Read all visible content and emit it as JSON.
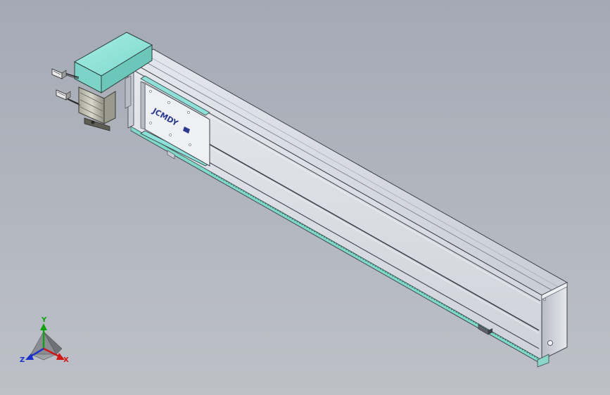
{
  "carriage": {
    "brand_label": "JCMDY",
    "brand_color": "#2a3a8c"
  },
  "triad": {
    "x_label": "X",
    "y_label": "Y",
    "z_label": "Z",
    "x_color": "#d01818",
    "y_color": "#10a010",
    "z_color": "#1a30c8"
  },
  "colors": {
    "background": "#aeb3bc",
    "motor_housing": "#8fe0d8",
    "rail_body": "#d8dbe2",
    "guide_strip": "#7fd8c8"
  }
}
